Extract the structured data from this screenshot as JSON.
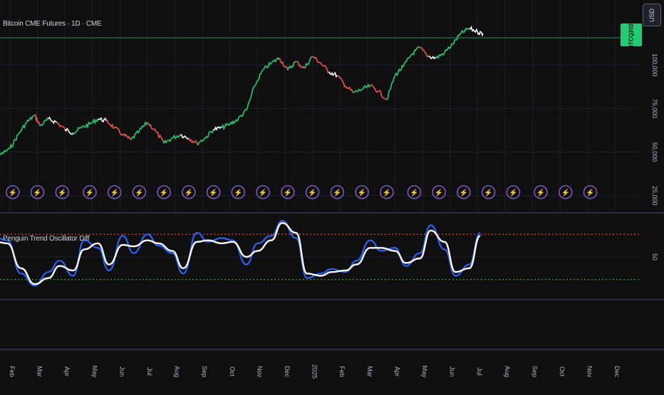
{
  "chart_title": "Bitcoin CME Futures · 1D · CME",
  "indicator_title": "Penguin Trend Oscillator Diff",
  "currency_button": "USD",
  "ticker_badge": "BTCQ2025",
  "colors": {
    "background": "#0f0f0f",
    "bull": "#1fce74",
    "bear": "#ef5350",
    "neutral": "#ffffff",
    "fast_line": "#2962ff",
    "slow_line": "#ffffff",
    "overbought": "#ef5350",
    "oversold": "#4caf50",
    "event_marker": "#7e57c2",
    "horizontal_line": "#1fce74"
  },
  "chart_data": [
    {
      "type": "line",
      "title": "Bitcoin CME Futures · 1D · CME",
      "y_ticks": [
        "100,000",
        "75,000",
        "50,000",
        "25,000"
      ],
      "y_tick_values": [
        100000,
        75000,
        50000,
        25000
      ],
      "ylim": [
        18000,
        125000
      ],
      "x_ticks": [
        "Feb",
        "Mar",
        "Apr",
        "May",
        "Jun",
        "Jul",
        "Aug",
        "Sep",
        "Oct",
        "Nov",
        "Dec",
        "2025",
        "Feb",
        "Mar",
        "Apr",
        "May",
        "Jun",
        "Jul",
        "Aug",
        "Sep",
        "Oct",
        "Nov",
        "Dec"
      ],
      "x_tick_times": [
        1,
        2,
        3,
        4,
        5,
        6,
        7,
        8,
        9,
        10,
        11,
        12,
        13,
        14,
        15,
        16,
        17,
        18,
        19,
        20,
        21,
        22,
        23
      ],
      "x_tick_note": "month index from Jan 2024 = 0",
      "series": [
        {
          "values_t": [
            0.0,
            0.3,
            0.6,
            1.0,
            1.3,
            1.6,
            1.9,
            2.1,
            2.4,
            2.7,
            3.0,
            3.3,
            3.6,
            3.9,
            4.2,
            4.5,
            4.8,
            5.1,
            5.4,
            5.7,
            6.0,
            6.3,
            6.6,
            6.9,
            7.2,
            7.5,
            7.8,
            8.1,
            8.4,
            8.7,
            9.0,
            9.3,
            9.6,
            9.9,
            10.2,
            10.5,
            10.8,
            11.1,
            11.4,
            11.7,
            12.0,
            12.3,
            12.6,
            12.9,
            13.2,
            13.5,
            13.8,
            14.1,
            14.4,
            14.7,
            15.0,
            15.3,
            15.6,
            15.9,
            16.2,
            16.5,
            16.8,
            17.1,
            17.4,
            17.7,
            18.0,
            18.2
          ],
          "values": [
            43000,
            44000,
            48000,
            52000,
            60000,
            67000,
            71000,
            65000,
            69000,
            67000,
            63000,
            61000,
            64000,
            66000,
            69000,
            68000,
            64000,
            60000,
            57000,
            62000,
            67000,
            62000,
            55000,
            58000,
            60000,
            58000,
            55000,
            58000,
            63000,
            64000,
            66000,
            69000,
            74000,
            88000,
            97000,
            101000,
            104000,
            97000,
            102000,
            98000,
            105000,
            101000,
            96000,
            94000,
            88000,
            84000,
            86000,
            88000,
            85000,
            80000,
            94000,
            99000,
            106000,
            110000,
            105000,
            104000,
            107000,
            112000,
            118000,
            121000,
            119000,
            118000
          ]
        }
      ]
    },
    {
      "type": "line",
      "title": "Penguin Trend Oscillator Diff",
      "y_ticks": [
        "50"
      ],
      "y_tick_values": [
        50
      ],
      "ylim": [
        0,
        100
      ],
      "overbought": 80,
      "oversold": 20,
      "series": [
        {
          "name": "",
          "values_t": [
            0.0,
            0.5,
            0.9,
            1.4,
            1.9,
            2.4,
            2.8,
            3.3,
            3.7,
            4.2,
            4.6,
            5.1,
            5.5,
            6.0,
            6.4,
            6.9,
            7.3,
            7.8,
            8.2,
            8.7,
            9.1,
            9.6,
            10.0,
            10.5,
            10.9,
            11.4,
            11.8,
            12.3,
            12.7,
            13.2,
            13.6,
            14.1,
            14.5,
            15.0,
            15.4,
            15.9,
            16.3,
            16.8,
            17.2,
            17.7,
            18.1
          ],
          "values": [
            55,
            75,
            72,
            28,
            12,
            30,
            45,
            25,
            72,
            62,
            32,
            78,
            55,
            80,
            65,
            55,
            28,
            82,
            70,
            75,
            72,
            40,
            68,
            78,
            98,
            75,
            22,
            28,
            34,
            30,
            45,
            72,
            58,
            62,
            38,
            55,
            92,
            60,
            25,
            40,
            82
          ]
        },
        {
          "name": "",
          "values_t": [
            0.0,
            0.5,
            0.9,
            1.4,
            1.9,
            2.4,
            2.8,
            3.3,
            3.7,
            4.2,
            4.6,
            5.1,
            5.5,
            6.0,
            6.4,
            6.9,
            7.3,
            7.8,
            8.2,
            8.7,
            9.1,
            9.6,
            10.0,
            10.5,
            10.9,
            11.4,
            11.8,
            12.3,
            12.7,
            13.2,
            13.6,
            14.1,
            14.5,
            15.0,
            15.4,
            15.9,
            16.3,
            16.8,
            17.2,
            17.7,
            18.1
          ],
          "values": [
            50,
            70,
            68,
            35,
            14,
            22,
            38,
            32,
            60,
            68,
            40,
            66,
            64,
            72,
            68,
            58,
            35,
            70,
            72,
            68,
            70,
            50,
            58,
            72,
            95,
            82,
            28,
            25,
            30,
            32,
            40,
            62,
            62,
            58,
            42,
            48,
            85,
            70,
            30,
            35,
            78
          ]
        }
      ]
    }
  ],
  "event_markers": {
    "symbol": "⚡",
    "times": [
      0.2,
      1.1,
      2.0,
      2.9,
      3.9,
      4.8,
      5.7,
      6.6,
      7.5,
      8.4,
      9.3,
      10.2,
      11.1,
      12.0,
      12.9,
      13.8,
      14.7,
      15.7,
      16.6,
      17.5,
      18.4,
      19.3,
      20.3,
      21.2,
      22.1
    ]
  }
}
